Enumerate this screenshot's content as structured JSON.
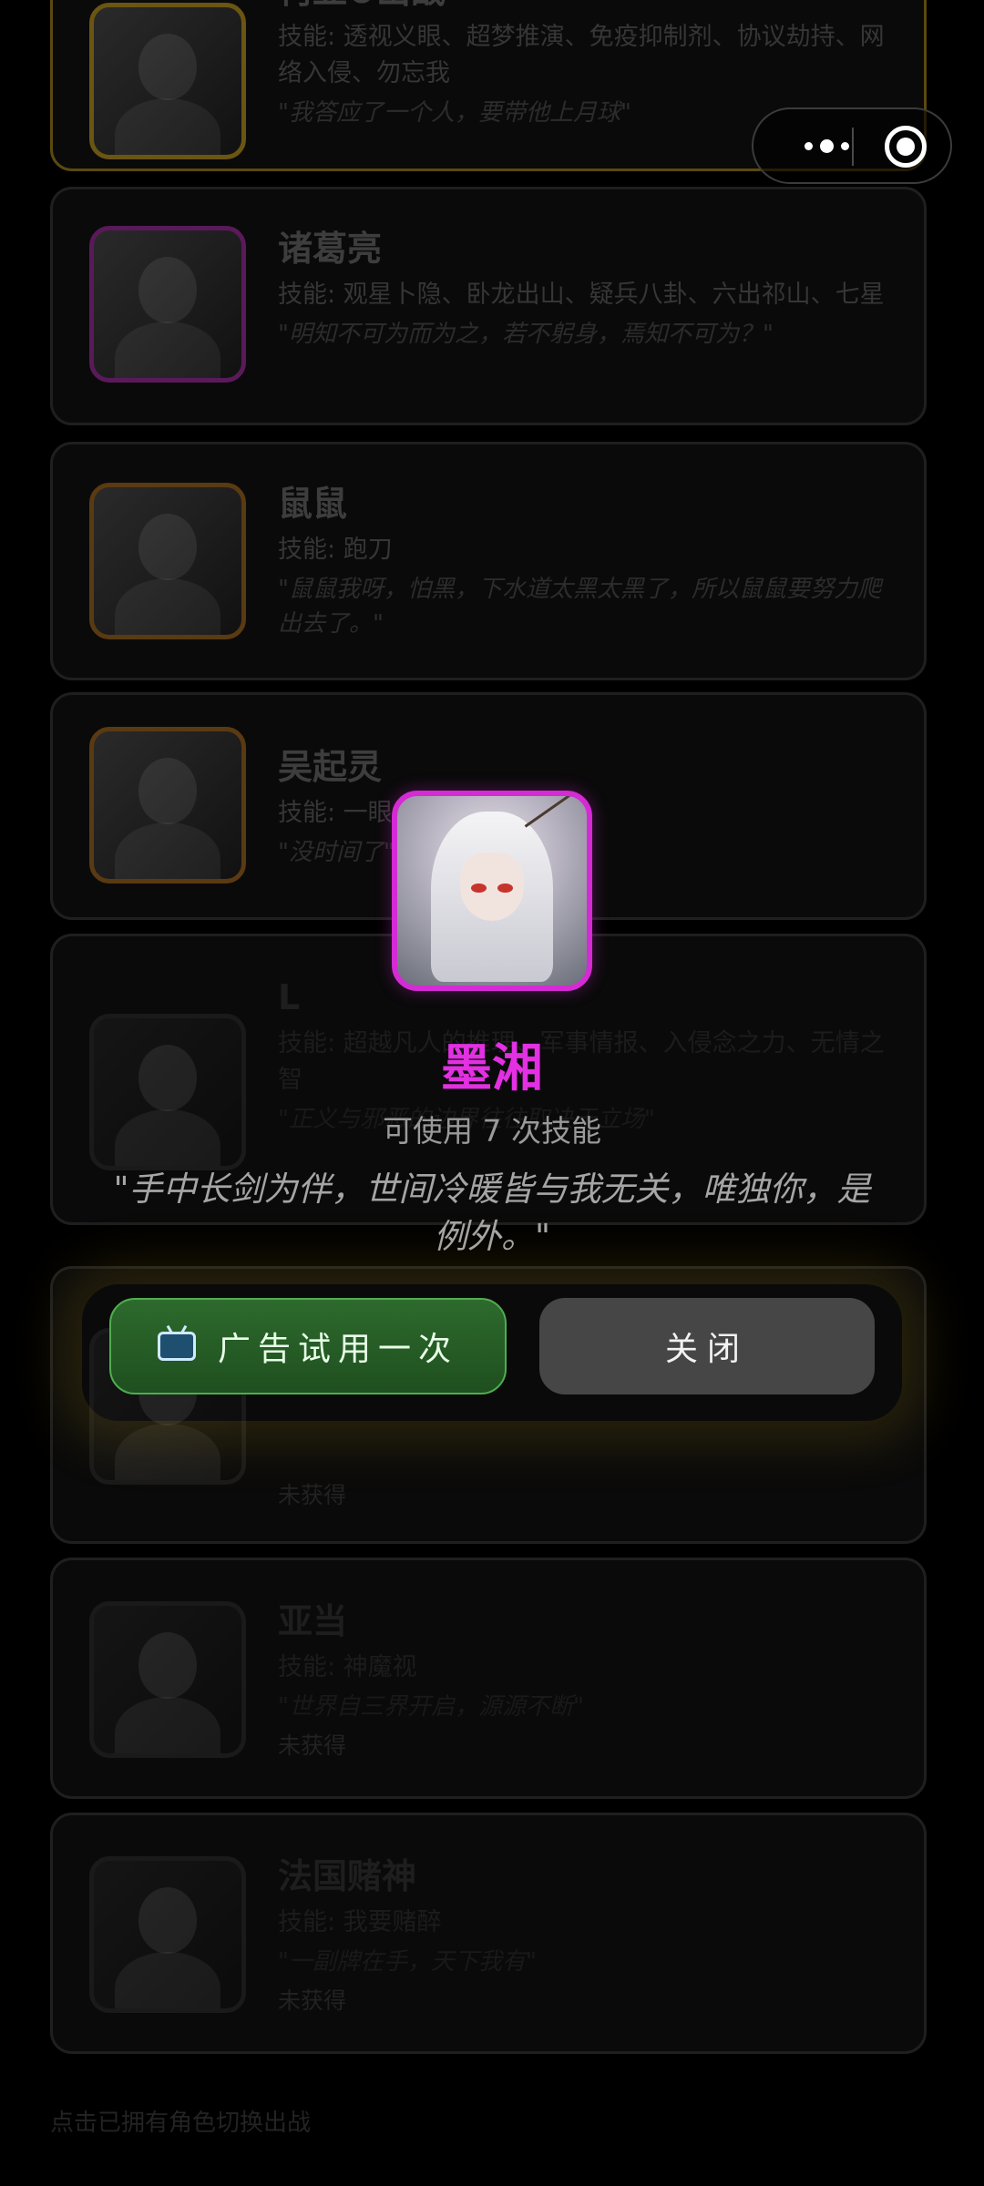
{
  "cards": [
    {
      "name": "柯亚✪出战",
      "skill": "技能: 透视义眼、超梦推演、免疫抑制剂、协议劫持、网络入侵、勿忘我",
      "quote": "\"我答应了一个人，要带他上月球\"",
      "status": ""
    },
    {
      "name": "诸葛亮",
      "skill": "技能: 观星卜隐、卧龙出山、疑兵八卦、六出祁山、七星",
      "quote": "\"明知不可为而为之，若不躬身，焉知不可为？\"",
      "status": ""
    },
    {
      "name": "鼠鼠",
      "skill": "技能: 跑刀",
      "quote": "\"鼠鼠我呀，怕黑，下水道太黑太黑了，所以鼠鼠要努力爬出去了。\"",
      "status": ""
    },
    {
      "name": "吴起灵",
      "skill": "技能: 一眼",
      "quote": "\"没时间了\"",
      "status": ""
    },
    {
      "name": "L",
      "skill": "技能: 超越凡人的推理、军事情报、入侵念之力、无情之智",
      "quote": "\"正义与邪恶的边界往往取决于立场\"",
      "status": ""
    },
    {
      "name": "",
      "skill": "",
      "quote": "",
      "status": "未获得"
    },
    {
      "name": "亚当",
      "skill": "技能: 神魔视",
      "quote": "\"世界自三界开启，源源不断\"",
      "status": "未获得"
    },
    {
      "name": "法国赌神",
      "skill": "技能: 我要赌醉",
      "quote": "\"一副牌在手，天下我有\"",
      "status": "未获得"
    }
  ],
  "footer_hint": "点击已拥有角色切换出战",
  "modal": {
    "name": "墨湘",
    "uses": "可使用 7 次技能",
    "quote": "\"手中长剑为伴，世间冷暖皆与我无关，唯独你，是例外。\"",
    "ad_label": "广告试用一次",
    "close_label": "关闭"
  },
  "colors": {
    "accent": "#e230e2",
    "ad_green": "#2d6a2d",
    "close_gray": "#464646"
  }
}
